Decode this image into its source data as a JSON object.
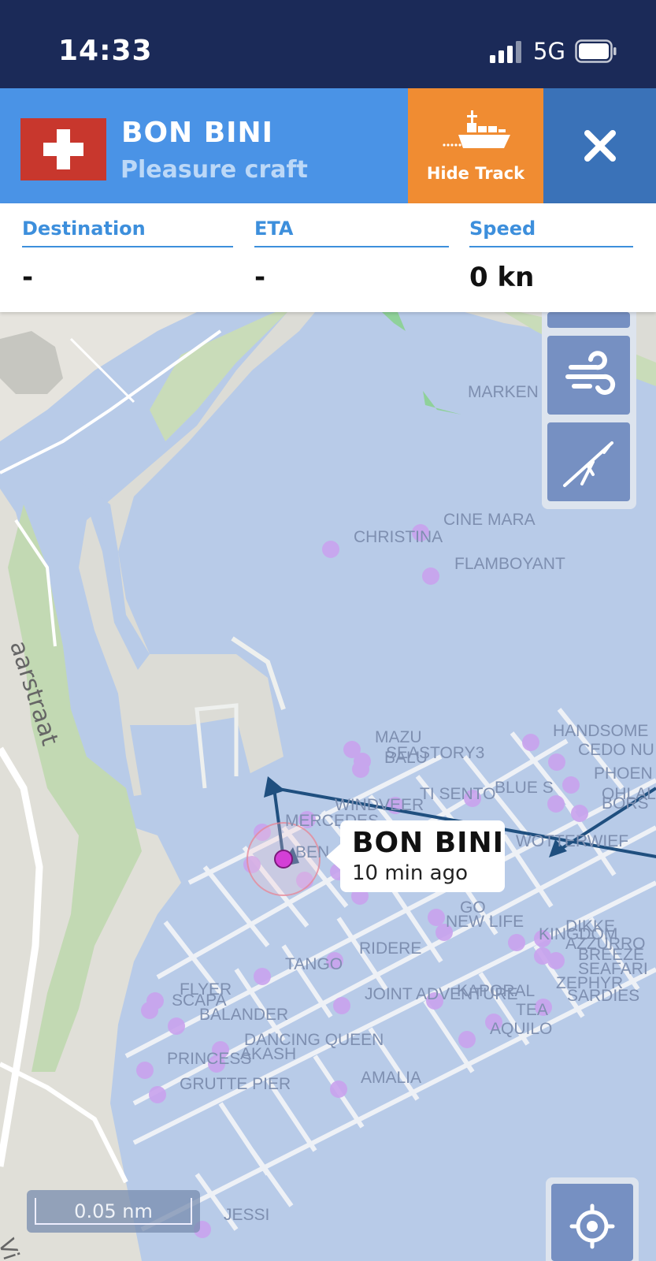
{
  "status_bar": {
    "time": "14:33",
    "network": "5G"
  },
  "vessel": {
    "name": "BON BINI",
    "type": "Pleasure craft",
    "flag_icon": "swiss-flag-icon",
    "hide_track_label": "Hide Track"
  },
  "info": {
    "destination_label": "Destination",
    "destination_value": "-",
    "eta_label": "ETA",
    "eta_value": "-",
    "speed_label": "Speed",
    "speed_value": "0 kn"
  },
  "map": {
    "tooltip_name": "BON BINI",
    "tooltip_time": "10 min ago",
    "scale": "0.05 nm",
    "street_label": "aarstraat",
    "street_label_2": "Vi",
    "vessel_labels": [
      "MARKEN",
      "CINE MARA",
      "CHRISTINA",
      "FLAMBOYANT",
      "MAZU",
      "SEASTORY3",
      "BALU",
      "HANDSOME",
      "CEDO NU",
      "PHOEN",
      "BLUE S",
      "OHLALA",
      "BORS",
      "TI SENTO",
      "WINDVEER",
      "MERCEDES",
      "WOTTERWIEF",
      "BEN",
      "GO",
      "NEW LIFE",
      "DIKKE",
      "KINGDOM",
      "AZZURRO",
      "BREEZE",
      "SEAFARI",
      "RIDERE",
      "TANGO",
      "FLYER",
      "SCAPA",
      "BALANDER",
      "JOINT ADVENTURE",
      "KAPORAL",
      "ZEPHYR",
      "TEA",
      "SARDIES",
      "AQUILO",
      "DANCING QUEEN",
      "AKASH",
      "PRINCESS",
      "GRUTTE PIER",
      "AMALIA",
      "JESSI"
    ]
  },
  "colors": {
    "header_bg": "#1b2a58",
    "vessel_bar": "#4a93e6",
    "hide_track": "#f08c32",
    "close": "#3a72b8",
    "water": "#b8cbe8",
    "vessel_dot": "#c9a3ee",
    "selected_vessel": "#d43fd6",
    "track": "#1f4f7f"
  }
}
